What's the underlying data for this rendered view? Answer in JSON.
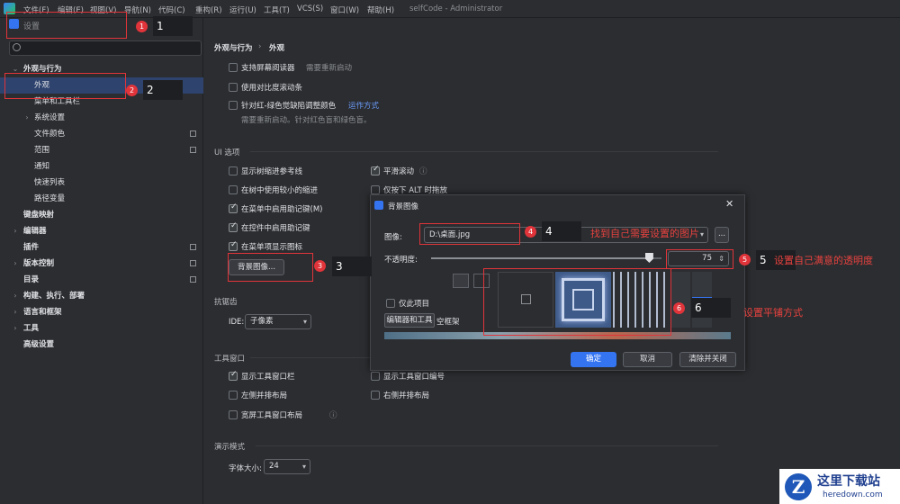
{
  "menubar": {
    "items": [
      "文件(F)",
      "编辑(E)",
      "视图(V)",
      "导航(N)",
      "代码(C)",
      "重构(R)",
      "运行(U)",
      "工具(T)",
      "VCS(S)",
      "窗口(W)",
      "帮助(H)"
    ],
    "project_title": "selfCode - Administrator"
  },
  "settings": {
    "title": "设置",
    "search_placeholder": "Q"
  },
  "sidebar": {
    "items": [
      {
        "label": "外观与行为",
        "level": 0,
        "expanded": true
      },
      {
        "label": "外观",
        "level": 1,
        "selected": true
      },
      {
        "label": "菜单和工具栏",
        "level": 1
      },
      {
        "label": "系统设置",
        "level": 1,
        "collapsed": true
      },
      {
        "label": "文件颜色",
        "level": 1
      },
      {
        "label": "范围",
        "level": 1
      },
      {
        "label": "通知",
        "level": 1
      },
      {
        "label": "快速列表",
        "level": 1
      },
      {
        "label": "路径变量",
        "level": 1
      },
      {
        "label": "键盘映射",
        "level": 0
      },
      {
        "label": "编辑器",
        "level": 0,
        "collapsed": true
      },
      {
        "label": "插件",
        "level": 0
      },
      {
        "label": "版本控制",
        "level": 0,
        "collapsed": true
      },
      {
        "label": "目录",
        "level": 0
      },
      {
        "label": "构建、执行、部署",
        "level": 0,
        "collapsed": true
      },
      {
        "label": "语言和框架",
        "level": 0,
        "collapsed": true
      },
      {
        "label": "工具",
        "level": 0,
        "collapsed": true
      },
      {
        "label": "高级设置",
        "level": 0
      }
    ]
  },
  "main": {
    "breadcrumb_parent": "外观与行为",
    "breadcrumb_sep": "›",
    "breadcrumb_current": "外观",
    "screen_reader": "支持屏幕阅读器",
    "restart_required": "需要重新启动",
    "high_contrast_scrollbars": "使用对比度滚动条",
    "color_blind": "针对红-绿色觉缺陷调整颜色",
    "how_it_works": "运作方式",
    "color_blind_note": "需要重新启动。针对红色盲和绿色盲。",
    "ui_options": "UI 选项",
    "tree_indent_guides": "显示树缩进参考线",
    "smaller_indent": "在树中使用较小的缩进",
    "menu_mnemonics": "在菜单中启用助记键(M)",
    "control_mnemonics": "在控件中启用助记键",
    "menu_icons": "在菜单项显示图标",
    "smooth_scroll": "平滑滚动",
    "alt_drag": "仅按下 ALT 时拖放",
    "bg_image_button": "背景图像...",
    "antialiasing": "抗锯齿",
    "ide_label": "IDE:",
    "ide_value": "子像素",
    "tool_windows": "工具窗口",
    "show_tool_window_bars": "显示工具窗口栏",
    "show_tool_window_numbers": "显示工具窗口编号",
    "left_side_by_side": "左侧并排布局",
    "right_side_by_side": "右侧并排布局",
    "widescreen_layout": "宽屏工具窗口布局",
    "presentation_mode": "演示模式",
    "font_size_label": "字体大小:",
    "font_size_value": "24"
  },
  "dialog": {
    "title": "背景图像",
    "image_label": "图像:",
    "image_value": "D:\\桌面.jpg",
    "browse": "...",
    "opacity_label": "不透明度:",
    "opacity_value": "75",
    "opacity_fraction": 0.75,
    "this_project_only": "仅此项目",
    "target_tab_editor": "编辑器和工具",
    "target_tab_empty": "空框架",
    "ok": "确定",
    "cancel": "取消",
    "clear_close": "清除并关闭"
  },
  "annotations": {
    "n1": "1",
    "n2": "2",
    "n3": "3",
    "n4": "4",
    "n5": "5",
    "n6": "6",
    "t4": "找到自己需要设置的图片",
    "t5": "设置自己满意的透明度",
    "t6": "设置平铺方式"
  },
  "watermark": {
    "brand": "这里下载站",
    "domain": "heredown.com"
  },
  "colors": {
    "selection": "#2e436e",
    "accent": "#3574f0",
    "annotation": "#e0343a"
  }
}
